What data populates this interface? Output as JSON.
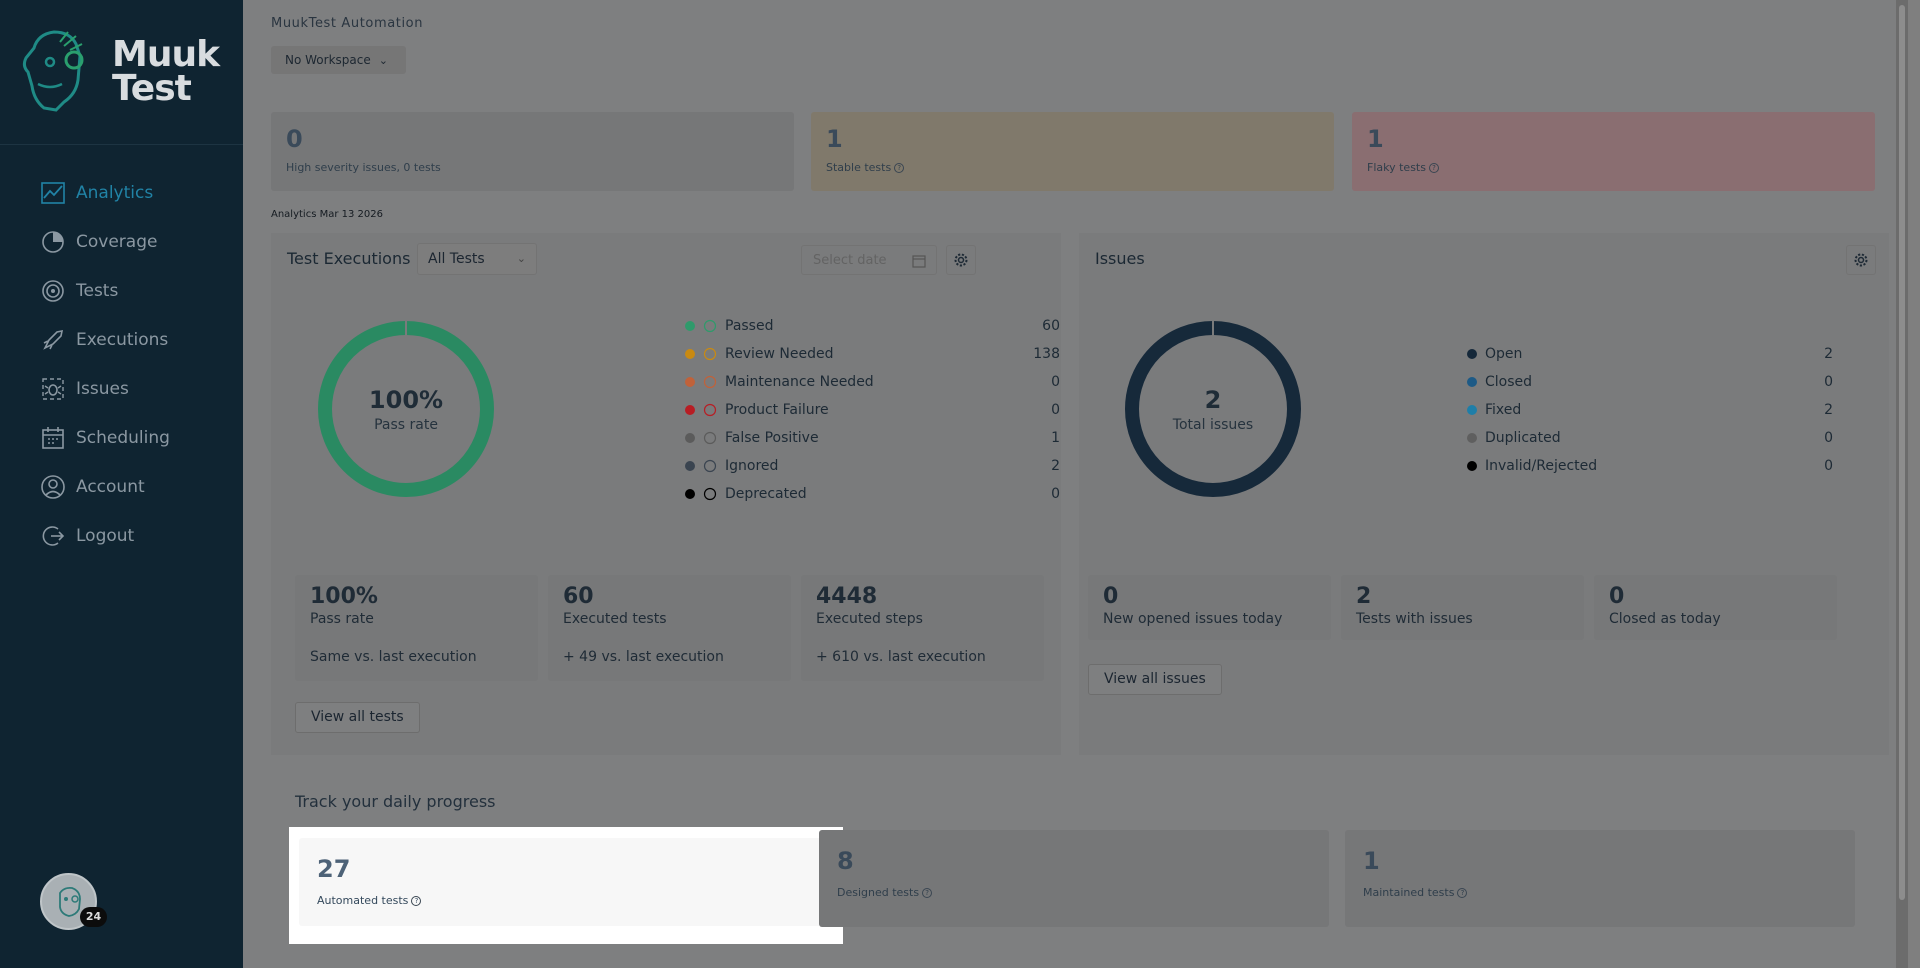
{
  "app": {
    "workspace_title": "MuukTest Automation",
    "workspace_select": "No Workspace"
  },
  "logo": {
    "line1": "Muuk",
    "line2": "Test"
  },
  "sidebar": {
    "items": [
      {
        "label": "Analytics",
        "icon": "analytics-icon",
        "active": true
      },
      {
        "label": "Coverage",
        "icon": "coverage-icon"
      },
      {
        "label": "Tests",
        "icon": "tests-icon"
      },
      {
        "label": "Executions",
        "icon": "executions-icon"
      },
      {
        "label": "Issues",
        "icon": "issues-icon"
      },
      {
        "label": "Scheduling",
        "icon": "scheduling-icon"
      },
      {
        "label": "Account",
        "icon": "account-icon"
      },
      {
        "label": "Logout",
        "icon": "logout-icon"
      }
    ],
    "avatar_badge": "24"
  },
  "summary": {
    "high_severity": {
      "value": "0",
      "label": "High severity issues, 0 tests"
    },
    "stable": {
      "value": "1",
      "label": "Stable tests"
    },
    "flaky": {
      "value": "1",
      "label": "Flaky tests"
    }
  },
  "analytics_date": "Analytics Mar 13 2026",
  "test_executions": {
    "title": "Test Executions",
    "filter": "All Tests",
    "date_placeholder": "Select date",
    "donut_value": "100%",
    "donut_label": "Pass rate",
    "legend": [
      {
        "label": "Passed",
        "value": "60",
        "color": "#2f9a6b",
        "icon": "check-circle-icon"
      },
      {
        "label": "Review Needed",
        "value": "138",
        "color": "#c98a12",
        "icon": "alert-circle-icon"
      },
      {
        "label": "Maintenance Needed",
        "value": "0",
        "color": "#c0623a",
        "icon": "tools-icon"
      },
      {
        "label": "Product Failure",
        "value": "0",
        "color": "#b81d24",
        "icon": "x-circle-icon"
      },
      {
        "label": "False Positive",
        "value": "1",
        "color": "#5b5b5b",
        "icon": "false-positive-icon"
      },
      {
        "label": "Ignored",
        "value": "2",
        "color": "#3a4450",
        "icon": "ban-icon"
      },
      {
        "label": "Deprecated",
        "value": "0",
        "color": "#000000",
        "icon": "minus-circle-icon"
      }
    ],
    "cards": [
      {
        "big": "100%",
        "sub": "Pass rate",
        "cmp": "Same vs. last execution"
      },
      {
        "big": "60",
        "sub": "Executed tests",
        "cmp": "+ 49 vs. last execution"
      },
      {
        "big": "4448",
        "sub": "Executed steps",
        "cmp": "+ 610 vs. last execution"
      }
    ],
    "view_all": "View all tests"
  },
  "issues": {
    "title": "Issues",
    "donut_value": "2",
    "donut_label": "Total issues",
    "legend": [
      {
        "label": "Open",
        "value": "2",
        "color": "#15283a"
      },
      {
        "label": "Closed",
        "value": "0",
        "color": "#1d5a86"
      },
      {
        "label": "Fixed",
        "value": "2",
        "color": "#1e7ea8"
      },
      {
        "label": "Duplicated",
        "value": "0",
        "color": "#5f5f5f"
      },
      {
        "label": "Invalid/Rejected",
        "value": "0",
        "color": "#000000"
      }
    ],
    "cards": [
      {
        "big": "0",
        "sub": "New opened issues today"
      },
      {
        "big": "2",
        "sub": "Tests with issues"
      },
      {
        "big": "0",
        "sub": "Closed as today"
      }
    ],
    "view_all": "View all issues"
  },
  "progress": {
    "title": "Track your daily progress",
    "automated": {
      "value": "27",
      "label": "Automated tests"
    },
    "designed": {
      "value": "8",
      "label": "Designed tests"
    },
    "maintained": {
      "value": "1",
      "label": "Maintained tests"
    }
  }
}
